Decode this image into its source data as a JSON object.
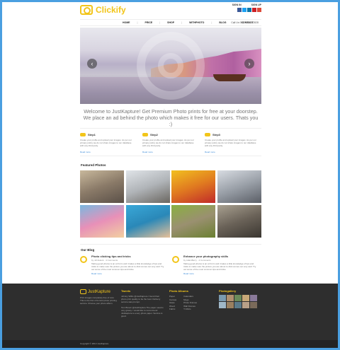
{
  "brand": {
    "name": "Clickify",
    "footer_name": "JustKapture",
    "accent": "#f2c51a",
    "link": "#3a8ad8"
  },
  "auth": {
    "sign_in": "SIGN IN",
    "sign_up": "SIGN UP"
  },
  "social": [
    {
      "icon": "facebook-icon",
      "color": "#3b5998"
    },
    {
      "icon": "twitter-icon",
      "color": "#1da1f2"
    },
    {
      "icon": "linkedin-icon",
      "color": "#0e76a8"
    },
    {
      "icon": "pinterest-icon",
      "color": "#cb2027"
    },
    {
      "icon": "google-plus-icon",
      "color": "#dd4b39"
    }
  ],
  "nav": {
    "items": [
      "HOME",
      "PRICE",
      "SHOP",
      "WITHPHOTO",
      "BLOG",
      "CONTACT"
    ],
    "call_us": "Call Us 091-7409162828"
  },
  "hero": {
    "prev": "‹",
    "next": "›"
  },
  "welcome": "Welcome to JustKapture! Get Premium Photo prints for free at your doorstep. We place an ad behind the photo which makes it free for our users. Thats you :)",
  "steps": [
    {
      "title": "Step1",
      "text": "Create your profile and upload your images. As per our privacy policy we do not share images to our database with any third party.",
      "more": "Read more"
    },
    {
      "title": "Step2",
      "text": "Create your profile and upload your images. As per our privacy policy we do not share images to our database with any third party.",
      "more": "Read more"
    },
    {
      "title": "Step3",
      "text": "Create your profile and upload your images. As per our privacy policy we do not share images to our database with any third party.",
      "more": "Read more"
    }
  ],
  "featured": {
    "title": "Featured Photos",
    "photos": [
      {
        "name": "rocky-landscape",
        "colors": [
          "#c8b89c",
          "#8a7a68",
          "#5a5048"
        ]
      },
      {
        "name": "beach-tree",
        "colors": [
          "#e0e4e8",
          "#b0b4b8",
          "#6a6660"
        ]
      },
      {
        "name": "colored-powder",
        "colors": [
          "#f2c020",
          "#e07a20",
          "#c02a2a"
        ]
      },
      {
        "name": "bridge",
        "colors": [
          "#d8dce2",
          "#9aa0a8",
          "#5a5e66"
        ]
      },
      {
        "name": "child-bubbles",
        "colors": [
          "#7ab8e0",
          "#e890b8",
          "#f2d0a0"
        ]
      },
      {
        "name": "kids-pool",
        "colors": [
          "#3aa8d8",
          "#2a88b8",
          "#e8c098"
        ]
      },
      {
        "name": "elephants",
        "colors": [
          "#8ab040",
          "#9a9070",
          "#6a8030"
        ]
      },
      {
        "name": "man-pigeons",
        "colors": [
          "#a8a090",
          "#6a6258",
          "#3a3630"
        ]
      }
    ]
  },
  "blog": {
    "title": "Our Blog",
    "posts": [
      {
        "title": "Photo clicking tips and tricks",
        "meta": "by JohnHenk · 4 Comments",
        "text": "Taking good photos is an art form and it takes a little knowledge of tips and tricks to make sure the picture you are about to click comes out very well. Try out some of the most common tips and tricks.",
        "more": "Read more"
      },
      {
        "title": "Enhance your photography skills",
        "meta": "by AdamBerry · 4 Comments",
        "text": "Taking good photos is an art form and it takes a little knowledge of tips and tricks to make sure the picture you are about to click comes out very well. Try out some of the most common tips and tricks.",
        "more": "Read more"
      }
    ]
  },
  "footer": {
    "about": "Print images completely free of cost. This is the first of its kind photo printing service. Choose your photo album.",
    "tweets_title": "Tweets",
    "tweets": [
      "Johnny Willis @JustKapture I found their photo print quality to be the best. Delivery service was prompt.",
      "Tom Brown @JustKapture The paper used is very glossy. I would like to recommend Justkapture to every photo paper. Service is good."
    ],
    "albums_title": "Photo Albums",
    "albums_a": [
      "Paper",
      "Canvas",
      "Glass",
      "Wood",
      "Fabric"
    ],
    "albums_b": [
      "Calendars",
      "Mugs",
      "Photo Frames",
      "Wall Frames",
      "T-Shirts"
    ],
    "gallery_title": "Photogallery",
    "gallery": [
      "#7a9ab0",
      "#b09070",
      "#6a8a5a",
      "#c8a878",
      "#8a7a9a",
      "#a0b8c8",
      "#9a8060",
      "#5a7a8a",
      "#b8a088",
      "#7a6a5a"
    ],
    "copyright": "Copyright © 2013 JustKapture"
  }
}
